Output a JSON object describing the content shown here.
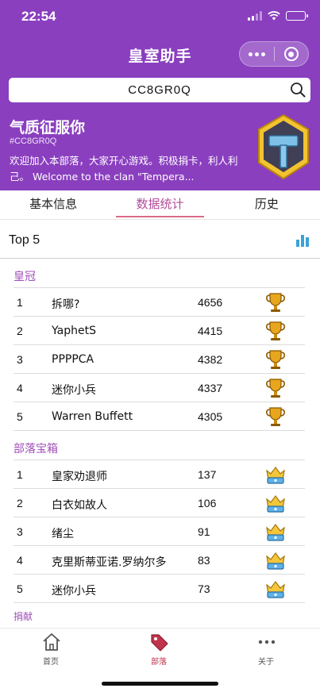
{
  "status_bar": {
    "time": "22:54"
  },
  "nav": {
    "title": "皇室助手"
  },
  "search": {
    "value": "CC8GR0Q"
  },
  "clan": {
    "name": "气质征服你",
    "tag": "#CC8GR0Q",
    "description": "欢迎加入本部落，大家开心游戏。积极捐卡，利人利己。 Welcome to the clan \"Tempera..."
  },
  "tabs": [
    {
      "label": "基本信息"
    },
    {
      "label": "数据统计"
    },
    {
      "label": "历史"
    }
  ],
  "panel": {
    "title": "Top 5"
  },
  "sections": {
    "crowns": {
      "title": "皇冠",
      "rows": [
        {
          "rank": "1",
          "name": "拆哪?",
          "value": "4656"
        },
        {
          "rank": "2",
          "name": "YaphetS",
          "value": "4415"
        },
        {
          "rank": "3",
          "name": "PPPPCA",
          "value": "4382"
        },
        {
          "rank": "4",
          "name": "迷你小兵",
          "value": "4337"
        },
        {
          "rank": "5",
          "name": "Warren Buffett",
          "value": "4305"
        }
      ]
    },
    "chest": {
      "title": "部落宝箱",
      "rows": [
        {
          "rank": "1",
          "name": "皇家劝退师",
          "value": "137"
        },
        {
          "rank": "2",
          "name": "白衣如故人",
          "value": "106"
        },
        {
          "rank": "3",
          "name": "绪尘",
          "value": "91"
        },
        {
          "rank": "4",
          "name": "克里斯蒂亚诺.罗纳尔多",
          "value": "83"
        },
        {
          "rank": "5",
          "name": "迷你小兵",
          "value": "73"
        }
      ]
    },
    "donations": {
      "title": "捐献"
    }
  },
  "bottom_nav": [
    {
      "label": "首页",
      "icon": "home-icon"
    },
    {
      "label": "部落",
      "icon": "tag-icon"
    },
    {
      "label": "关于",
      "icon": "more-icon"
    }
  ],
  "colors": {
    "primary": "#8a3fbf",
    "accent": "#b04c9a",
    "active_nav": "#c0344d"
  }
}
